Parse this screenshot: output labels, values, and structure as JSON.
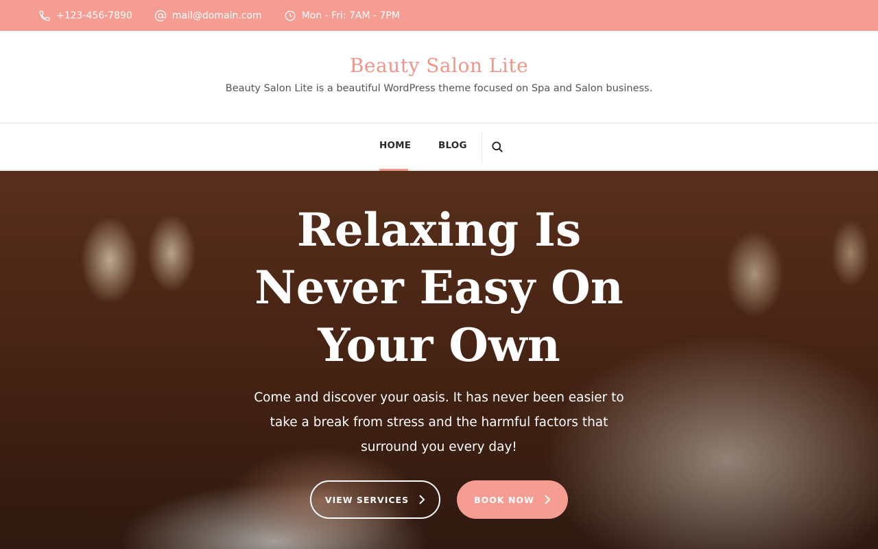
{
  "topbar": {
    "phone": "+123-456-7890",
    "email": "mail@domain.com",
    "hours": "Mon - Fri: 7AM - 7PM"
  },
  "header": {
    "title": "Beauty Salon Lite",
    "tagline": "Beauty Salon Lite is a beautiful WordPress theme focused on Spa and Salon business."
  },
  "nav": {
    "items": [
      {
        "label": "HOME",
        "active": true
      },
      {
        "label": "BLOG",
        "active": false
      }
    ],
    "search_icon": "search-icon"
  },
  "hero": {
    "title": "Relaxing Is Never Easy On Your Own",
    "text": "Come and discover your oasis. It has never been easier to take a break from stress and the harmful factors that surround you every day!",
    "buttons": {
      "services": "VIEW SERVICES",
      "book": "BOOK NOW"
    }
  },
  "colors": {
    "accent": "#f59d92",
    "title": "#f0958a"
  }
}
